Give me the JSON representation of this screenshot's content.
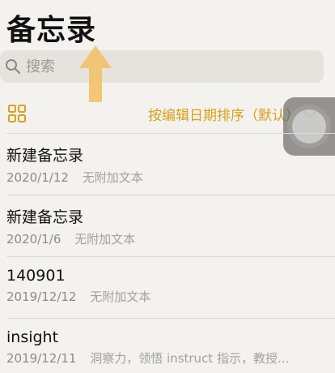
{
  "header": {
    "title": "备忘录"
  },
  "search": {
    "placeholder": "搜索"
  },
  "toolbar": {
    "sort_label": "按编辑日期排序（默认）"
  },
  "icons": {
    "search": "search-icon",
    "grid": "grid-icon",
    "chevron": "chevron-down-icon",
    "pointer": "arrow-up-icon"
  },
  "colors": {
    "accent": "#d6a11e",
    "background": "#f4f2ee",
    "search_bg": "#e6e3de"
  },
  "notes": [
    {
      "title": "新建备忘录",
      "date": "2020/1/12",
      "preview": "无附加文本"
    },
    {
      "title": "新建备忘录",
      "date": "2020/1/6",
      "preview": "无附加文本"
    },
    {
      "title": "140901",
      "date": "2019/12/12",
      "preview": "无附加文本"
    },
    {
      "title": "insight",
      "date": "2019/12/11",
      "preview": "洞察力，领悟 instruct 指示，教授..."
    }
  ]
}
